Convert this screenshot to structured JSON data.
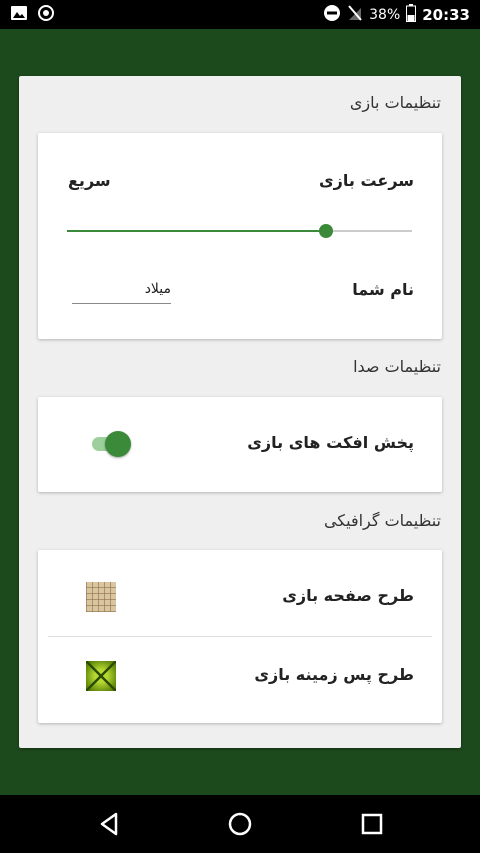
{
  "status_bar": {
    "battery": "38%",
    "time": "20:33",
    "icons": [
      "image-icon",
      "record-icon",
      "dnd-icon",
      "no-signal-icon",
      "battery-icon"
    ]
  },
  "game_settings": {
    "title": "تنظیمات بازی",
    "speed_label": "سرعت بازی",
    "speed_value_label": "سریع",
    "speed_level_percent": 75,
    "name_label": "نام شما",
    "name_value": "میلاد"
  },
  "sound_settings": {
    "title": "تنظیمات صدا",
    "effects_label": "پخش افکت های بازی",
    "effects_on": true
  },
  "graphics_settings": {
    "title": "تنظیمات گرافیکی",
    "board_design_label": "طرح صفحه بازی",
    "background_design_label": "طرح پس زمینه بازی"
  },
  "navigation": [
    "back-icon",
    "home-icon",
    "recents-icon"
  ],
  "colors": {
    "accent": "#3a8a3a",
    "background": "#1d4a1d",
    "panel": "#efefef"
  }
}
